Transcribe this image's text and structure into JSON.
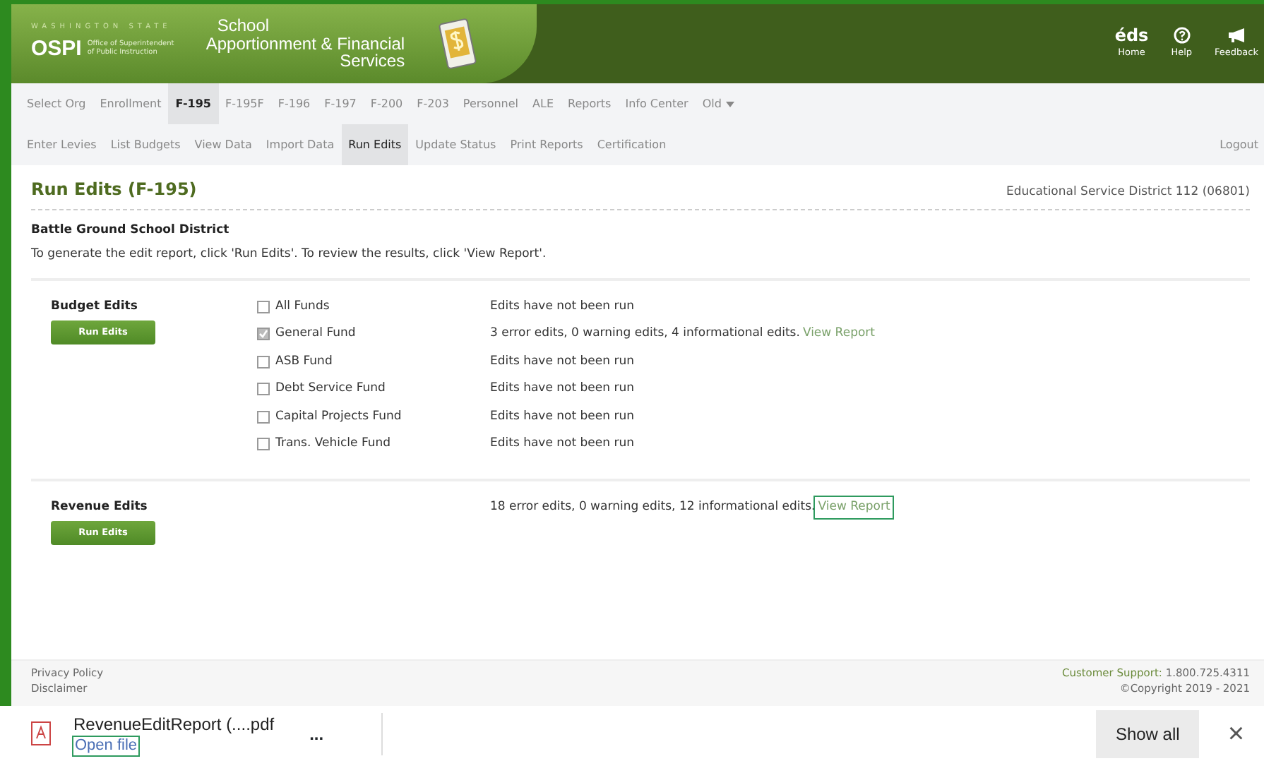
{
  "header": {
    "state_label": "WASHINGTON STATE",
    "agency_acronym": "OSPI",
    "agency_name": "Office of Superintendent of Public Instruction",
    "app_title": [
      "School",
      "Apportionment & Financial",
      "Services"
    ],
    "actions": [
      {
        "kind": "logo",
        "glyph": "éds",
        "label": "Home"
      },
      {
        "kind": "help",
        "label": "Help"
      },
      {
        "kind": "feedback",
        "label": "Feedback"
      }
    ]
  },
  "nav_primary": [
    {
      "label": "Select Org",
      "selected": false
    },
    {
      "label": "Enrollment",
      "selected": false
    },
    {
      "label": "F-195",
      "selected": true
    },
    {
      "label": "F-195F",
      "selected": false
    },
    {
      "label": "F-196",
      "selected": false
    },
    {
      "label": "F-197",
      "selected": false
    },
    {
      "label": "F-200",
      "selected": false
    },
    {
      "label": "F-203",
      "selected": false
    },
    {
      "label": "Personnel",
      "selected": false
    },
    {
      "label": "ALE",
      "selected": false
    },
    {
      "label": "Reports",
      "selected": false
    },
    {
      "label": "Info Center",
      "selected": false
    },
    {
      "label": "Old",
      "selected": false,
      "dropdown": true
    }
  ],
  "nav_secondary": [
    {
      "label": "Enter Levies",
      "selected": false
    },
    {
      "label": "List Budgets",
      "selected": false
    },
    {
      "label": "View Data",
      "selected": false
    },
    {
      "label": "Import Data",
      "selected": false
    },
    {
      "label": "Run Edits",
      "selected": true
    },
    {
      "label": "Update Status",
      "selected": false
    },
    {
      "label": "Print Reports",
      "selected": false
    },
    {
      "label": "Certification",
      "selected": false
    }
  ],
  "logout": "Logout",
  "page": {
    "title": "Run Edits (F-195)",
    "organization_scope": "Educational Service District 112 (06801)",
    "district": "Battle Ground School District",
    "instructions": "To generate the edit report, click 'Run Edits'. To review the results, click 'View Report'."
  },
  "budget_edits": {
    "label": "Budget Edits",
    "button": "Run Edits",
    "funds": [
      {
        "name": "All Funds",
        "checked": false,
        "status": "Edits have not been run"
      },
      {
        "name": "General Fund",
        "checked": true,
        "status": "3 error edits, 0 warning edits, 4 informational edits.",
        "link": {
          "label": "View Report",
          "focused": false
        }
      },
      {
        "name": "ASB Fund",
        "checked": false,
        "status": "Edits have not been run"
      },
      {
        "name": "Debt Service Fund",
        "checked": false,
        "status": "Edits have not been run"
      },
      {
        "name": "Capital Projects Fund",
        "checked": false,
        "status": "Edits have not been run"
      },
      {
        "name": "Trans. Vehicle Fund",
        "checked": false,
        "status": "Edits have not been run"
      }
    ]
  },
  "revenue_edits": {
    "label": "Revenue Edits",
    "button": "Run Edits",
    "status": "18 error edits, 0 warning edits, 12 informational edits.",
    "link": {
      "label": "View Report",
      "focused": true
    }
  },
  "footer": {
    "links": [
      "Privacy Policy",
      "Disclaimer"
    ],
    "support_label": "Customer Support:",
    "support_phone": "1.800.725.4311",
    "copyright": "©Copyright 2019 - 2021"
  },
  "download_bar": {
    "file_name": "RevenueEditReport (....pdf",
    "open_link": {
      "label": "Open file",
      "focused": true
    },
    "more": "...",
    "show_all": "Show all",
    "close": "×"
  }
}
